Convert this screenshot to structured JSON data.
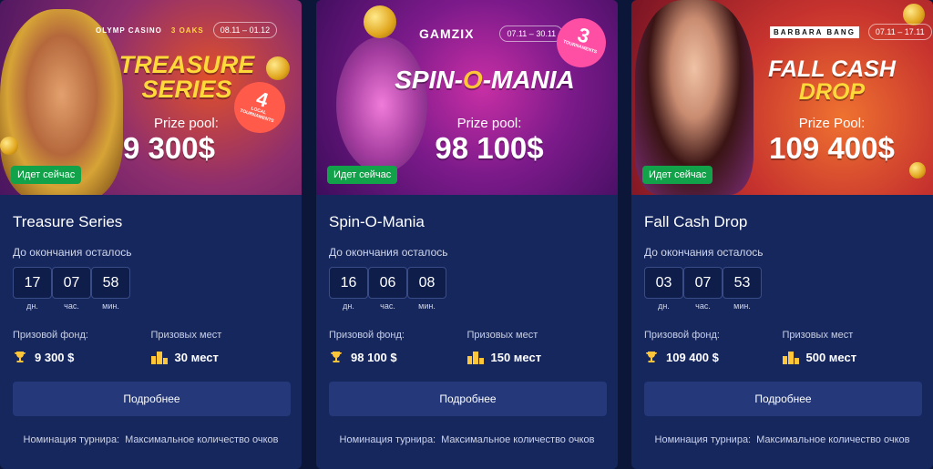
{
  "tournaments": [
    {
      "name": "Treasure Series",
      "banner": {
        "logos": [
          "OLYMP CASINO",
          "3 OAKS"
        ],
        "dates": "08.11 – 01.12",
        "title_line1": "TREASURE",
        "title_line2": "SERIES",
        "badge_number": "4",
        "badge_text": "LOCAL TOURNAMENTS",
        "pool_label": "Prize pool:",
        "pool_value": "9 300$",
        "status": "Идет сейчас"
      },
      "countdown_label": "До окончания осталось",
      "countdown": [
        {
          "value": "17",
          "unit": "дн."
        },
        {
          "value": "07",
          "unit": "час."
        },
        {
          "value": "58",
          "unit": "мин."
        }
      ],
      "prize_fund_label": "Призовой фонд:",
      "prize_fund": "9 300 $",
      "places_label": "Призовых мест",
      "places": "30 мест",
      "button_label": "Подробнее",
      "nomination_label": "Номинация турнира:",
      "nomination_value": "Максимальное количество очков"
    },
    {
      "name": "Spin-O-Mania",
      "banner": {
        "logos": [
          "GAMZIX"
        ],
        "dates": "07.11 – 30.11",
        "title_line1": "SPIN-",
        "title_mid": "O",
        "title_line2": "-MANIA",
        "badge_number": "3",
        "badge_text": "TOURNAMENTS",
        "pool_label": "Prize pool:",
        "pool_value": "98 100$",
        "status": "Идет сейчас"
      },
      "countdown_label": "До окончания осталось",
      "countdown": [
        {
          "value": "16",
          "unit": "дн."
        },
        {
          "value": "06",
          "unit": "час."
        },
        {
          "value": "08",
          "unit": "мин."
        }
      ],
      "prize_fund_label": "Призовой фонд:",
      "prize_fund": "98 100 $",
      "places_label": "Призовых мест",
      "places": "150 мест",
      "button_label": "Подробнее",
      "nomination_label": "Номинация турнира:",
      "nomination_value": "Максимальное количество очков"
    },
    {
      "name": "Fall Cash Drop",
      "banner": {
        "logos": [
          "BARBARA BANG"
        ],
        "dates": "07.11 – 17.11",
        "title_line1": "FALL CASH",
        "title_line2": "DROP",
        "pool_label": "Prize Pool:",
        "pool_value": "109 400$",
        "status": "Идет сейчас"
      },
      "countdown_label": "До окончания осталось",
      "countdown": [
        {
          "value": "03",
          "unit": "дн."
        },
        {
          "value": "07",
          "unit": "час."
        },
        {
          "value": "53",
          "unit": "мин."
        }
      ],
      "prize_fund_label": "Призовой фонд:",
      "prize_fund": "109 400 $",
      "places_label": "Призовых мест",
      "places": "500 мест",
      "button_label": "Подробнее",
      "nomination_label": "Номинация турнира:",
      "nomination_value": "Максимальное количество очков"
    }
  ],
  "icons": {
    "prize_fund": "trophy-icon",
    "places": "podium-icon"
  },
  "colors": {
    "background": "#0c1638",
    "card": "#16275e",
    "status_green": "#12a34a",
    "button": "#24387a",
    "gold": "#ffc63a"
  }
}
